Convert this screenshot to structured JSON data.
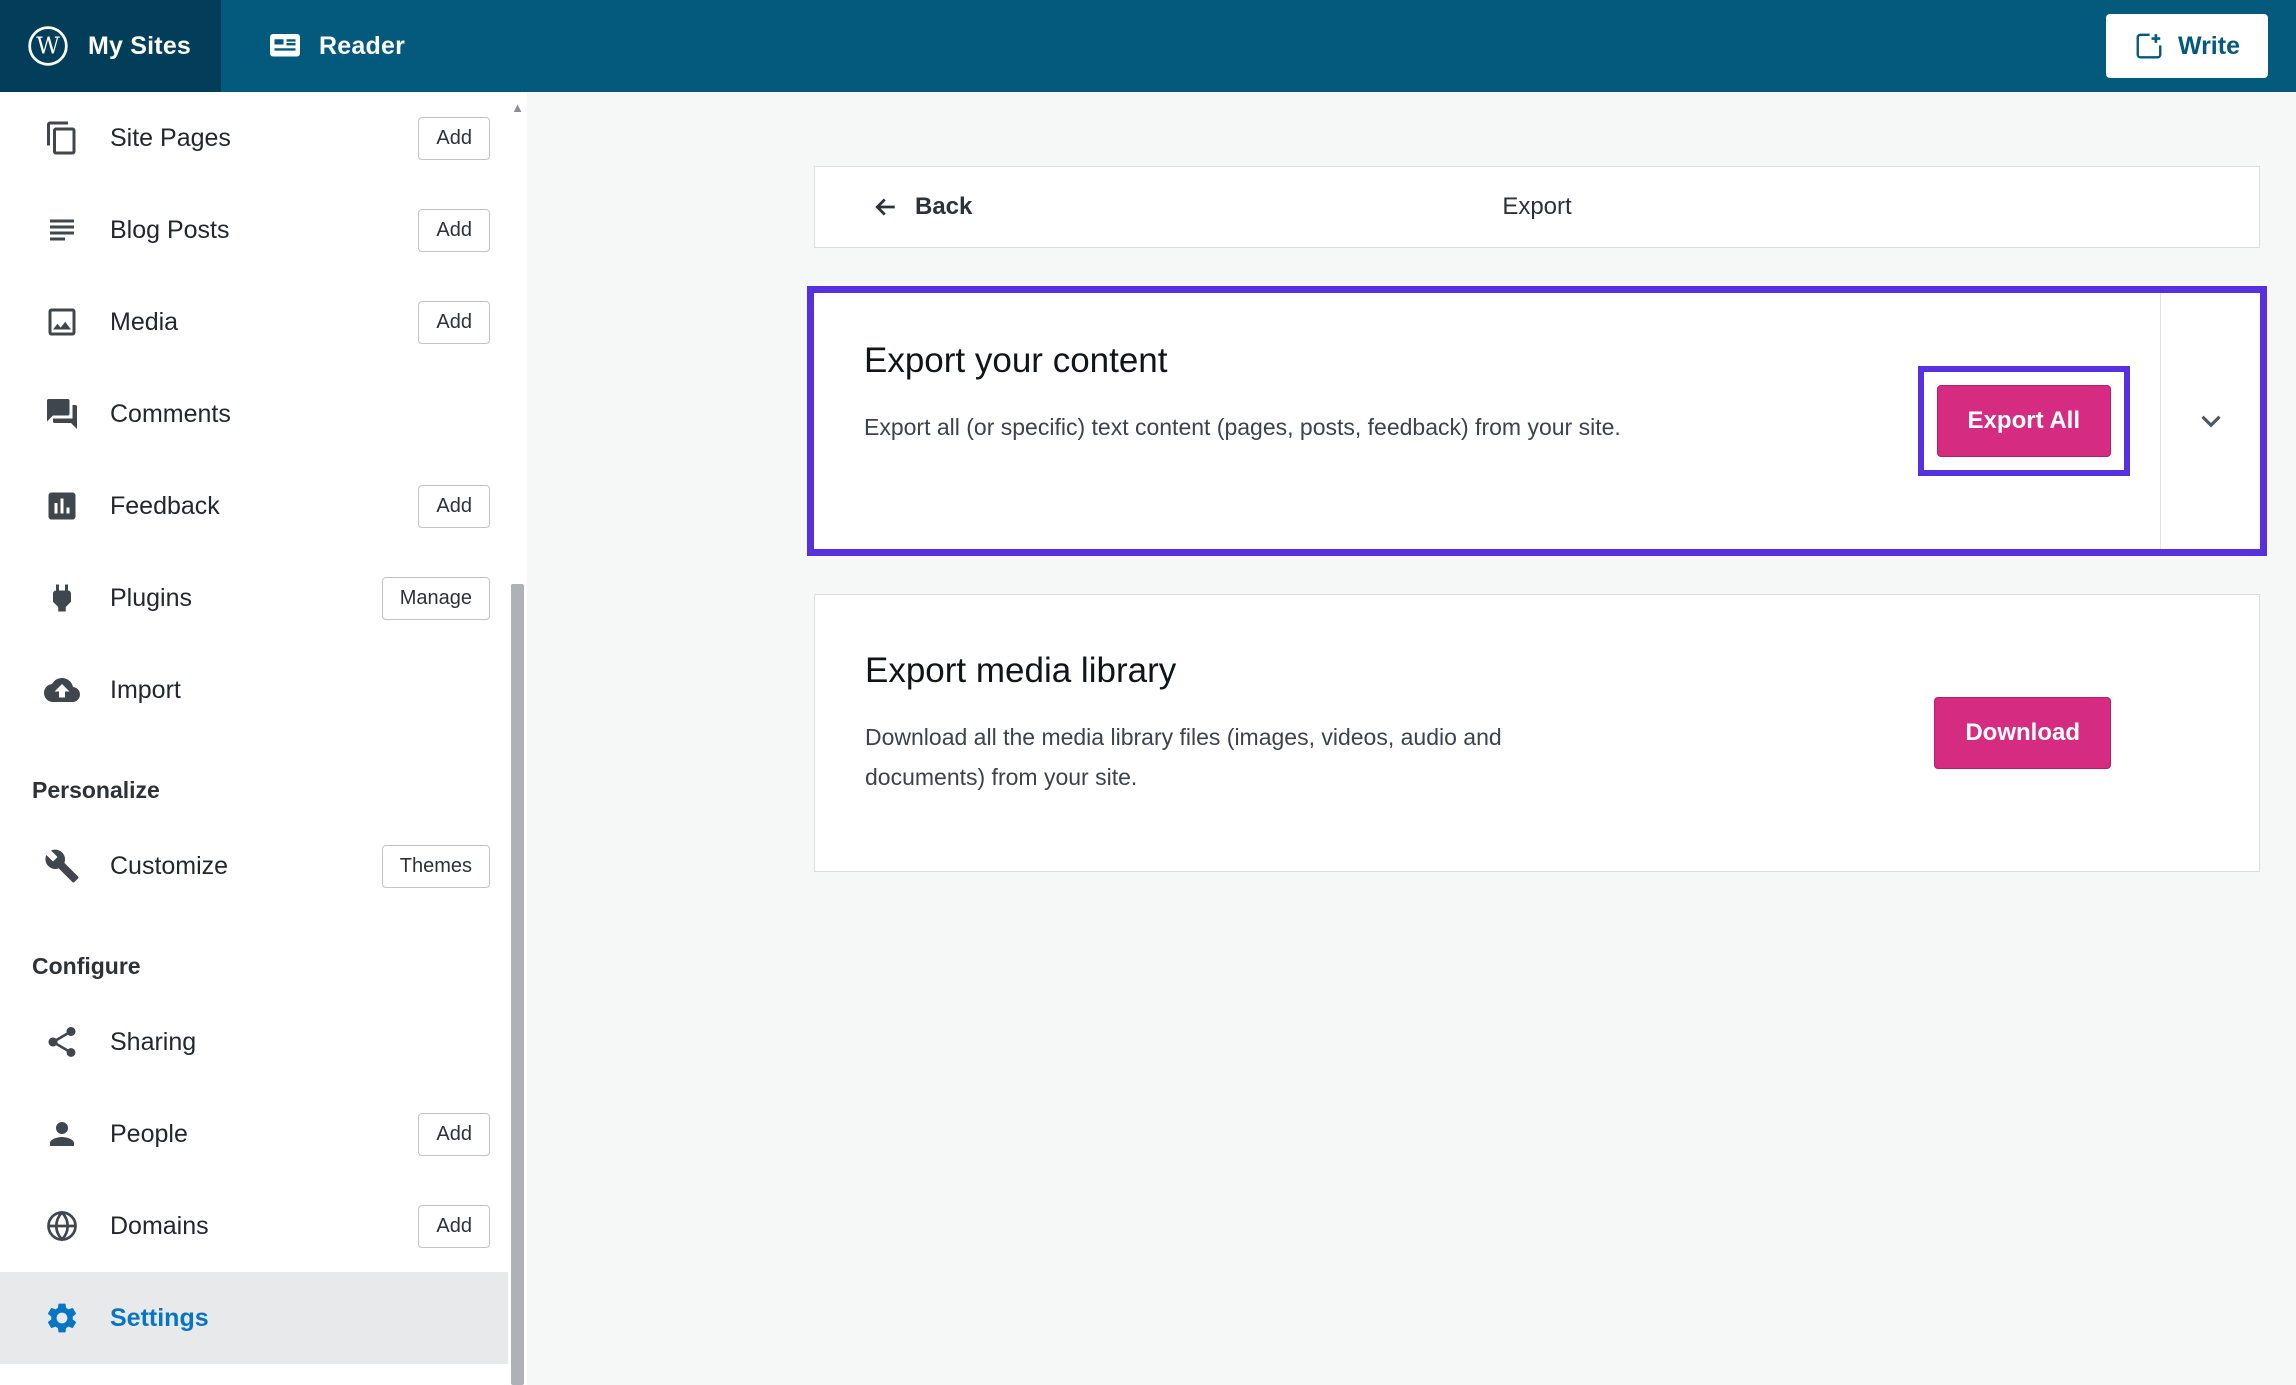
{
  "colors": {
    "masthead": "#045a7d",
    "masthead_dark": "#023e59",
    "pink": "#d52c82",
    "pink_dark": "#b11f6a",
    "purple": "#5731e0",
    "blue": "#0675c4"
  },
  "masthead": {
    "my_sites": "My Sites",
    "reader": "Reader",
    "write": "Write"
  },
  "sidebar": {
    "sections": {
      "personalize": "Personalize",
      "configure": "Configure"
    },
    "items": {
      "site_pages": {
        "label": "Site Pages",
        "badge": "Add"
      },
      "blog_posts": {
        "label": "Blog Posts",
        "badge": "Add"
      },
      "media": {
        "label": "Media",
        "badge": "Add"
      },
      "comments": {
        "label": "Comments"
      },
      "feedback": {
        "label": "Feedback",
        "badge": "Add"
      },
      "plugins": {
        "label": "Plugins",
        "badge": "Manage"
      },
      "import": {
        "label": "Import"
      },
      "customize": {
        "label": "Customize",
        "badge": "Themes"
      },
      "sharing": {
        "label": "Sharing"
      },
      "people": {
        "label": "People",
        "badge": "Add"
      },
      "domains": {
        "label": "Domains",
        "badge": "Add"
      },
      "settings": {
        "label": "Settings"
      }
    },
    "scroll_up_glyph": "▲"
  },
  "main": {
    "header": {
      "back": "Back",
      "title": "Export"
    },
    "export_content": {
      "title": "Export your content",
      "description": "Export all (or specific) text content (pages, posts, feedback) from your site.",
      "button": "Export All"
    },
    "export_media": {
      "title": "Export media library",
      "description": "Download all the media library files (images, videos, audio and documents) from your site.",
      "button": "Download"
    }
  }
}
